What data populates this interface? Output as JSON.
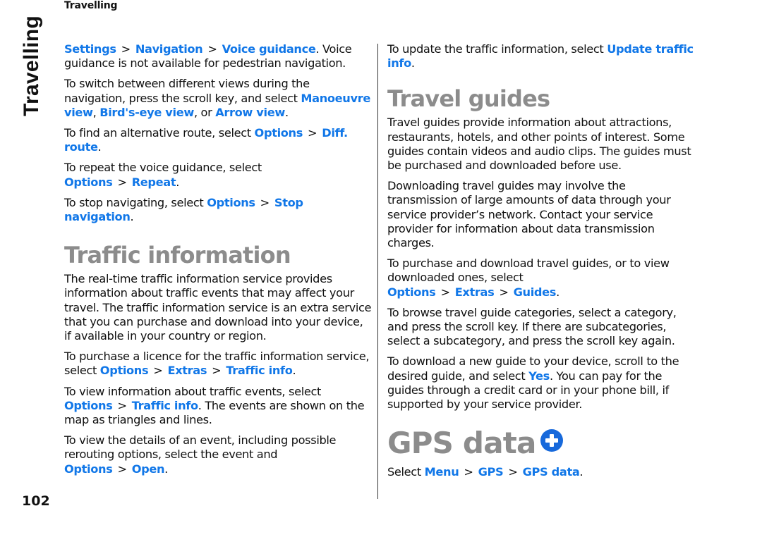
{
  "running_head": "Travelling",
  "side_tab": "Travelling",
  "page_number": "102",
  "colors": {
    "link": "#1177e8",
    "heading": "#8c8c8c",
    "icon": "#1769db"
  },
  "left": {
    "p1": {
      "l1": "Settings",
      "l2": "Navigation",
      "l3": "Voice guidance",
      "tail": ". Voice guidance is not available for pedestrian navigation."
    },
    "p2": {
      "text": "To switch between different views during the navigation, press the scroll key, and select ",
      "l1": "Manoeuvre view",
      "mid1": ", ",
      "l2": "Bird's-eye view",
      "mid2": ", or ",
      "l3": "Arrow view",
      "tail": "."
    },
    "p3": {
      "text": "To find an alternative route, select ",
      "l1": "Options",
      "l2": "Diff. route",
      "tail": "."
    },
    "p4": {
      "text": "To repeat the voice guidance, select ",
      "l1": "Options",
      "l2": "Repeat",
      "tail": "."
    },
    "p5": {
      "text": "To stop navigating, select ",
      "l1": "Options",
      "l2": "Stop navigation",
      "tail": "."
    },
    "heading": "Traffic information",
    "p6": "The real-time traffic information service provides information about traffic events that may affect your travel. The traffic information service is an extra service that you can purchase and download into your device, if available in your country or region.",
    "p7": {
      "text": "To purchase a licence for the traffic information service, select ",
      "l1": "Options",
      "l2": "Extras",
      "l3": "Traffic info",
      "tail": "."
    },
    "p8": {
      "text": "To view information about traffic events, select ",
      "l1": "Options",
      "l2": "Traffic info",
      "tail": ". The events are shown on the map as triangles and lines."
    },
    "p9": {
      "text": "To view the details of an event, including possible rerouting options, select the event and ",
      "l1": "Options",
      "l2": "Open",
      "tail": "."
    }
  },
  "right": {
    "p1": {
      "text": "To update the traffic information, select ",
      "l1": "Update traffic info",
      "tail": "."
    },
    "heading1": "Travel guides",
    "p2": "Travel guides provide information about attractions, restaurants, hotels, and other points of interest. Some guides contain videos and audio clips. The guides must be purchased and downloaded before use.",
    "p3": "Downloading travel guides may involve the transmission of large amounts of data through your service provider’s network. Contact your service provider for information about data transmission charges.",
    "p4": {
      "text": "To purchase and download travel guides, or to view downloaded ones, select ",
      "l1": "Options",
      "l2": "Extras",
      "l3": "Guides",
      "tail": "."
    },
    "p5": "To browse travel guide categories, select a category, and press the scroll key. If there are subcategories, select a subcategory, and press the scroll key again.",
    "p6": {
      "text": "To download a new guide to your device, scroll to the desired guide, and select ",
      "l1": "Yes",
      "tail": ". You can pay for the guides through a credit card or in your phone bill, if supported by your service provider."
    },
    "heading2": "GPS data",
    "heading2_icon": "plus-circle-icon",
    "p7": {
      "text": "Select ",
      "l1": "Menu",
      "l2": "GPS",
      "l3": "GPS data",
      "tail": "."
    }
  },
  "separator": ">"
}
